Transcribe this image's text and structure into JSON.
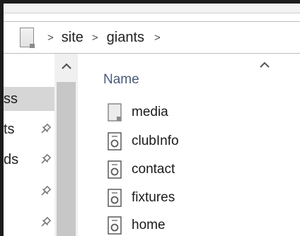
{
  "breadcrumb": {
    "items": [
      "site",
      "giants"
    ],
    "separator": ">"
  },
  "nav": {
    "items": [
      {
        "label": "ss",
        "pinned": false,
        "selected": true
      },
      {
        "label": "ts",
        "pinned": true,
        "selected": false
      },
      {
        "label": "ds",
        "pinned": true,
        "selected": false
      },
      {
        "label": "",
        "pinned": true,
        "selected": false
      },
      {
        "label": "",
        "pinned": true,
        "selected": false
      }
    ],
    "pin_icon": "pin-icon"
  },
  "file_list": {
    "column_header": "Name",
    "sort_direction": "ascending",
    "files": [
      {
        "name": "media",
        "type": "folder",
        "icon": "folder-icon"
      },
      {
        "name": "clubInfo",
        "type": "file",
        "icon": "file-icon"
      },
      {
        "name": "contact",
        "type": "file",
        "icon": "file-icon"
      },
      {
        "name": "fixtures",
        "type": "file",
        "icon": "file-icon"
      },
      {
        "name": "home",
        "type": "file",
        "icon": "file-icon"
      }
    ]
  },
  "colors": {
    "selection": "#d6d6d6",
    "header_text": "#4a5a7a",
    "frame": "#1c1c1c",
    "scroll_thumb": "#c7c7c7"
  }
}
